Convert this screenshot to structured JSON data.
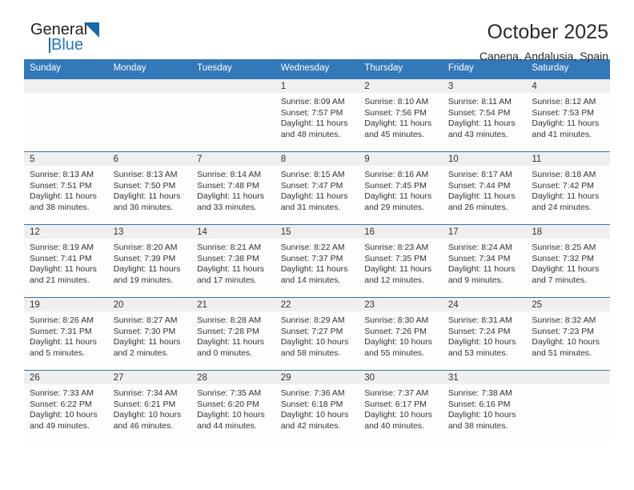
{
  "brand": {
    "name_top": "General",
    "name_bottom": "Blue",
    "logo_icon": "triangle-logo-icon",
    "accent_color": "#1769aa"
  },
  "header": {
    "month_title": "October 2025",
    "location": "Canena, Andalusia, Spain"
  },
  "calendar": {
    "header_bg": "#3378b8",
    "weekdays": [
      "Sunday",
      "Monday",
      "Tuesday",
      "Wednesday",
      "Thursday",
      "Friday",
      "Saturday"
    ],
    "labels": {
      "sunrise": "Sunrise:",
      "sunset": "Sunset:",
      "daylight": "Daylight:"
    },
    "weeks": [
      [
        {
          "day": "",
          "sunrise": "",
          "sunset": "",
          "daylight_line1": "",
          "daylight_line2": ""
        },
        {
          "day": "",
          "sunrise": "",
          "sunset": "",
          "daylight_line1": "",
          "daylight_line2": ""
        },
        {
          "day": "",
          "sunrise": "",
          "sunset": "",
          "daylight_line1": "",
          "daylight_line2": ""
        },
        {
          "day": "1",
          "sunrise": "Sunrise: 8:09 AM",
          "sunset": "Sunset: 7:57 PM",
          "daylight_line1": "Daylight: 11 hours",
          "daylight_line2": "and 48 minutes."
        },
        {
          "day": "2",
          "sunrise": "Sunrise: 8:10 AM",
          "sunset": "Sunset: 7:56 PM",
          "daylight_line1": "Daylight: 11 hours",
          "daylight_line2": "and 45 minutes."
        },
        {
          "day": "3",
          "sunrise": "Sunrise: 8:11 AM",
          "sunset": "Sunset: 7:54 PM",
          "daylight_line1": "Daylight: 11 hours",
          "daylight_line2": "and 43 minutes."
        },
        {
          "day": "4",
          "sunrise": "Sunrise: 8:12 AM",
          "sunset": "Sunset: 7:53 PM",
          "daylight_line1": "Daylight: 11 hours",
          "daylight_line2": "and 41 minutes."
        }
      ],
      [
        {
          "day": "5",
          "sunrise": "Sunrise: 8:13 AM",
          "sunset": "Sunset: 7:51 PM",
          "daylight_line1": "Daylight: 11 hours",
          "daylight_line2": "and 38 minutes."
        },
        {
          "day": "6",
          "sunrise": "Sunrise: 8:13 AM",
          "sunset": "Sunset: 7:50 PM",
          "daylight_line1": "Daylight: 11 hours",
          "daylight_line2": "and 36 minutes."
        },
        {
          "day": "7",
          "sunrise": "Sunrise: 8:14 AM",
          "sunset": "Sunset: 7:48 PM",
          "daylight_line1": "Daylight: 11 hours",
          "daylight_line2": "and 33 minutes."
        },
        {
          "day": "8",
          "sunrise": "Sunrise: 8:15 AM",
          "sunset": "Sunset: 7:47 PM",
          "daylight_line1": "Daylight: 11 hours",
          "daylight_line2": "and 31 minutes."
        },
        {
          "day": "9",
          "sunrise": "Sunrise: 8:16 AM",
          "sunset": "Sunset: 7:45 PM",
          "daylight_line1": "Daylight: 11 hours",
          "daylight_line2": "and 29 minutes."
        },
        {
          "day": "10",
          "sunrise": "Sunrise: 8:17 AM",
          "sunset": "Sunset: 7:44 PM",
          "daylight_line1": "Daylight: 11 hours",
          "daylight_line2": "and 26 minutes."
        },
        {
          "day": "11",
          "sunrise": "Sunrise: 8:18 AM",
          "sunset": "Sunset: 7:42 PM",
          "daylight_line1": "Daylight: 11 hours",
          "daylight_line2": "and 24 minutes."
        }
      ],
      [
        {
          "day": "12",
          "sunrise": "Sunrise: 8:19 AM",
          "sunset": "Sunset: 7:41 PM",
          "daylight_line1": "Daylight: 11 hours",
          "daylight_line2": "and 21 minutes."
        },
        {
          "day": "13",
          "sunrise": "Sunrise: 8:20 AM",
          "sunset": "Sunset: 7:39 PM",
          "daylight_line1": "Daylight: 11 hours",
          "daylight_line2": "and 19 minutes."
        },
        {
          "day": "14",
          "sunrise": "Sunrise: 8:21 AM",
          "sunset": "Sunset: 7:38 PM",
          "daylight_line1": "Daylight: 11 hours",
          "daylight_line2": "and 17 minutes."
        },
        {
          "day": "15",
          "sunrise": "Sunrise: 8:22 AM",
          "sunset": "Sunset: 7:37 PM",
          "daylight_line1": "Daylight: 11 hours",
          "daylight_line2": "and 14 minutes."
        },
        {
          "day": "16",
          "sunrise": "Sunrise: 8:23 AM",
          "sunset": "Sunset: 7:35 PM",
          "daylight_line1": "Daylight: 11 hours",
          "daylight_line2": "and 12 minutes."
        },
        {
          "day": "17",
          "sunrise": "Sunrise: 8:24 AM",
          "sunset": "Sunset: 7:34 PM",
          "daylight_line1": "Daylight: 11 hours",
          "daylight_line2": "and 9 minutes."
        },
        {
          "day": "18",
          "sunrise": "Sunrise: 8:25 AM",
          "sunset": "Sunset: 7:32 PM",
          "daylight_line1": "Daylight: 11 hours",
          "daylight_line2": "and 7 minutes."
        }
      ],
      [
        {
          "day": "19",
          "sunrise": "Sunrise: 8:26 AM",
          "sunset": "Sunset: 7:31 PM",
          "daylight_line1": "Daylight: 11 hours",
          "daylight_line2": "and 5 minutes."
        },
        {
          "day": "20",
          "sunrise": "Sunrise: 8:27 AM",
          "sunset": "Sunset: 7:30 PM",
          "daylight_line1": "Daylight: 11 hours",
          "daylight_line2": "and 2 minutes."
        },
        {
          "day": "21",
          "sunrise": "Sunrise: 8:28 AM",
          "sunset": "Sunset: 7:28 PM",
          "daylight_line1": "Daylight: 11 hours",
          "daylight_line2": "and 0 minutes."
        },
        {
          "day": "22",
          "sunrise": "Sunrise: 8:29 AM",
          "sunset": "Sunset: 7:27 PM",
          "daylight_line1": "Daylight: 10 hours",
          "daylight_line2": "and 58 minutes."
        },
        {
          "day": "23",
          "sunrise": "Sunrise: 8:30 AM",
          "sunset": "Sunset: 7:26 PM",
          "daylight_line1": "Daylight: 10 hours",
          "daylight_line2": "and 55 minutes."
        },
        {
          "day": "24",
          "sunrise": "Sunrise: 8:31 AM",
          "sunset": "Sunset: 7:24 PM",
          "daylight_line1": "Daylight: 10 hours",
          "daylight_line2": "and 53 minutes."
        },
        {
          "day": "25",
          "sunrise": "Sunrise: 8:32 AM",
          "sunset": "Sunset: 7:23 PM",
          "daylight_line1": "Daylight: 10 hours",
          "daylight_line2": "and 51 minutes."
        }
      ],
      [
        {
          "day": "26",
          "sunrise": "Sunrise: 7:33 AM",
          "sunset": "Sunset: 6:22 PM",
          "daylight_line1": "Daylight: 10 hours",
          "daylight_line2": "and 49 minutes."
        },
        {
          "day": "27",
          "sunrise": "Sunrise: 7:34 AM",
          "sunset": "Sunset: 6:21 PM",
          "daylight_line1": "Daylight: 10 hours",
          "daylight_line2": "and 46 minutes."
        },
        {
          "day": "28",
          "sunrise": "Sunrise: 7:35 AM",
          "sunset": "Sunset: 6:20 PM",
          "daylight_line1": "Daylight: 10 hours",
          "daylight_line2": "and 44 minutes."
        },
        {
          "day": "29",
          "sunrise": "Sunrise: 7:36 AM",
          "sunset": "Sunset: 6:18 PM",
          "daylight_line1": "Daylight: 10 hours",
          "daylight_line2": "and 42 minutes."
        },
        {
          "day": "30",
          "sunrise": "Sunrise: 7:37 AM",
          "sunset": "Sunset: 6:17 PM",
          "daylight_line1": "Daylight: 10 hours",
          "daylight_line2": "and 40 minutes."
        },
        {
          "day": "31",
          "sunrise": "Sunrise: 7:38 AM",
          "sunset": "Sunset: 6:16 PM",
          "daylight_line1": "Daylight: 10 hours",
          "daylight_line2": "and 38 minutes."
        },
        {
          "day": "",
          "sunrise": "",
          "sunset": "",
          "daylight_line1": "",
          "daylight_line2": ""
        }
      ]
    ]
  }
}
